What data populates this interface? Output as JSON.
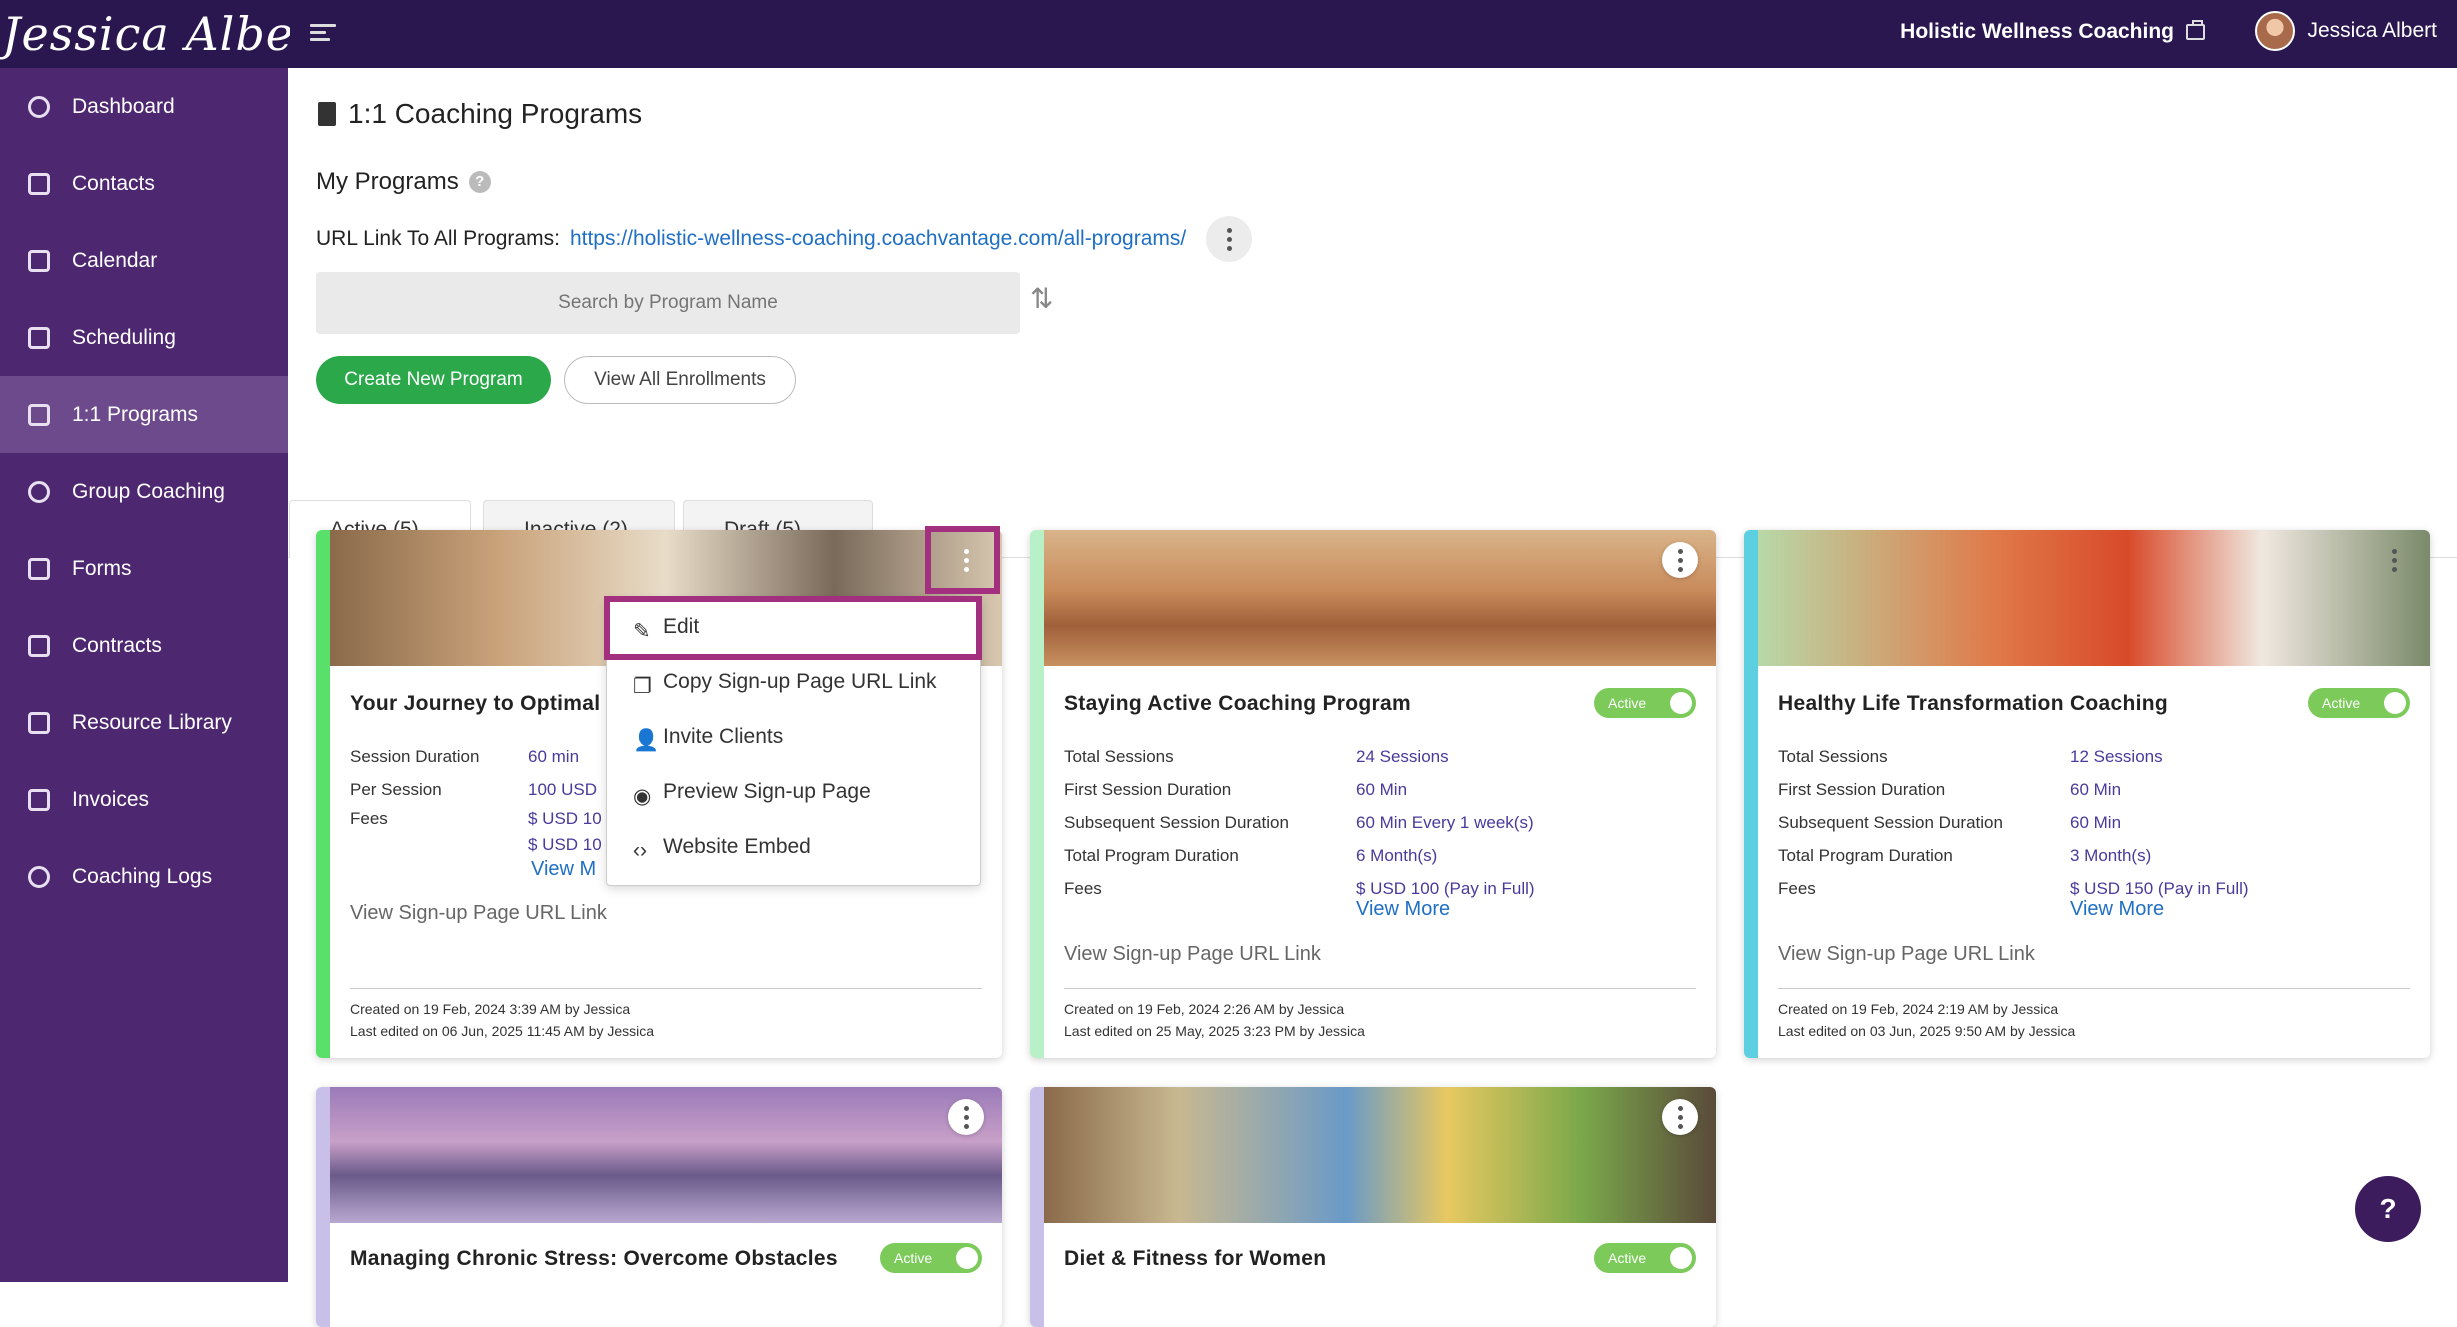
{
  "header": {
    "logo_text": "Jessica Albert",
    "company": "Holistic Wellness Coaching",
    "user_name": "Jessica Albert"
  },
  "sidebar": {
    "items": [
      {
        "label": "Dashboard",
        "icon": "dashboard-icon"
      },
      {
        "label": "Contacts",
        "icon": "contacts-icon"
      },
      {
        "label": "Calendar",
        "icon": "calendar-icon"
      },
      {
        "label": "Scheduling",
        "icon": "scheduling-icon"
      },
      {
        "label": "1:1 Programs",
        "icon": "book-icon"
      },
      {
        "label": "Group Coaching",
        "icon": "group-icon"
      },
      {
        "label": "Forms",
        "icon": "forms-icon"
      },
      {
        "label": "Contracts",
        "icon": "contracts-icon"
      },
      {
        "label": "Resource Library",
        "icon": "library-icon"
      },
      {
        "label": "Invoices",
        "icon": "invoice-icon"
      },
      {
        "label": "Coaching Logs",
        "icon": "clock-icon"
      }
    ]
  },
  "page": {
    "title": "1:1 Coaching Programs",
    "section_title": "My Programs",
    "url_label": "URL Link To All Programs:",
    "url": "https://holistic-wellness-coaching.coachvantage.com/all-programs/",
    "search_placeholder": "Search by Program Name",
    "create_button": "Create New Program",
    "enrollments_button": "View All Enrollments",
    "tabs": [
      "Active (5)",
      "Inactive (2)",
      "Draft (5)"
    ]
  },
  "cards": [
    {
      "title": "Your Journey to Optimal",
      "rows": [
        {
          "label": "Session Duration",
          "value": "60 min"
        },
        {
          "label": "Per Session",
          "value": "100 USD"
        },
        {
          "label": "Fees",
          "value": "$ USD 10"
        },
        {
          "label": "",
          "value": "$ USD 10"
        }
      ],
      "view_more": "View M",
      "signup_link": "View Sign-up Page URL Link",
      "created": "Created on 19 Feb, 2024 3:39 AM by Jessica",
      "edited": "Last edited on 06 Jun, 2025 11:45 AM by Jessica"
    },
    {
      "title": "Staying Active Coaching Program",
      "status": "Active",
      "rows": [
        {
          "label": "Total Sessions",
          "value": "24 Sessions"
        },
        {
          "label": "First Session Duration",
          "value": "60 Min"
        },
        {
          "label": "Subsequent Session Duration",
          "value": "60 Min Every 1 week(s)"
        },
        {
          "label": "Total Program Duration",
          "value": "6 Month(s)"
        },
        {
          "label": "Fees",
          "value": "$ USD 100 (Pay in Full)"
        }
      ],
      "view_more": "View More",
      "signup_link": "View Sign-up Page URL Link",
      "created": "Created on 19 Feb, 2024 2:26 AM by Jessica",
      "edited": "Last edited on 25 May, 2025 3:23 PM by Jessica"
    },
    {
      "title": "Healthy Life Transformation Coaching",
      "status": "Active",
      "rows": [
        {
          "label": "Total Sessions",
          "value": "12 Sessions"
        },
        {
          "label": "First Session Duration",
          "value": "60 Min"
        },
        {
          "label": "Subsequent Session Duration",
          "value": "60 Min"
        },
        {
          "label": "Total Program Duration",
          "value": "3 Month(s)"
        },
        {
          "label": "Fees",
          "value": "$ USD 150 (Pay in Full)"
        }
      ],
      "view_more": "View More",
      "signup_link": "View Sign-up Page URL Link",
      "created": "Created on 19 Feb, 2024 2:19 AM by Jessica",
      "edited": "Last edited on 03 Jun, 2025 9:50 AM by Jessica"
    },
    {
      "title": "Managing Chronic Stress: Overcome Obstacles",
      "status": "Active"
    },
    {
      "title": "Diet & Fitness for Women",
      "status": "Active"
    }
  ],
  "menu": {
    "items": [
      {
        "label": "Edit",
        "icon": "pencil-icon"
      },
      {
        "label": "Copy Sign-up Page URL Link",
        "icon": "copy-icon"
      },
      {
        "label": "Invite Clients",
        "icon": "invite-icon"
      },
      {
        "label": "Preview Sign-up Page",
        "icon": "eye-icon"
      },
      {
        "label": "Website Embed",
        "icon": "code-icon"
      }
    ]
  },
  "help_fab": "?",
  "colors": {
    "topbar": "#2a1750",
    "sidebar": "#4e2771",
    "accent_green": "#2aa84a",
    "link": "#1f6fc4",
    "highlight": "#a2307e"
  }
}
